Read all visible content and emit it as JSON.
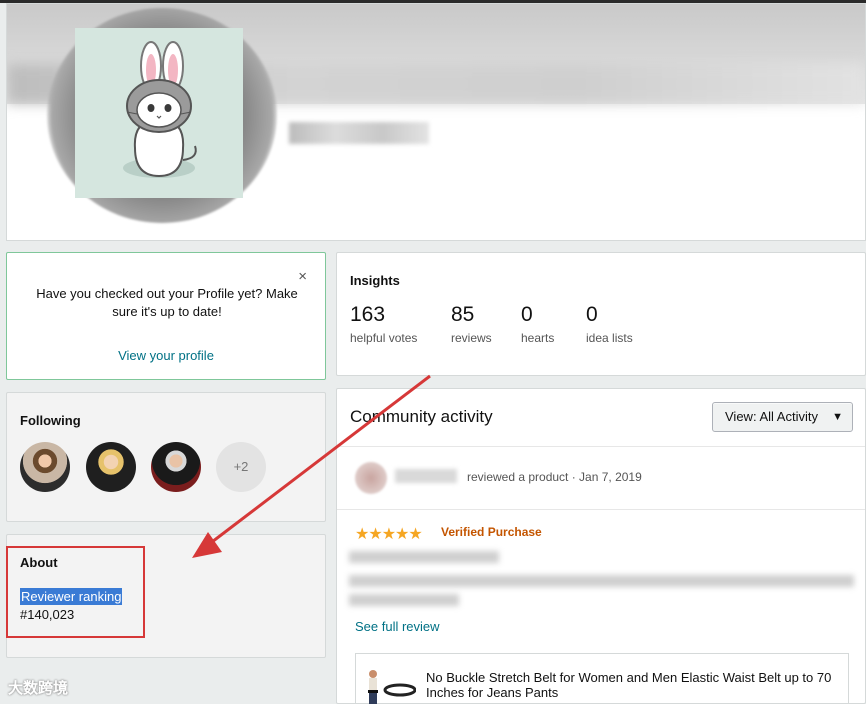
{
  "profile": {
    "avatar_alt": "bunny-hat cat avatar"
  },
  "profile_prompt": {
    "text": "Have you checked out your Profile yet? Make sure it's up to date!",
    "link": "View your profile",
    "close": "×"
  },
  "following": {
    "title": "Following",
    "more": "+2"
  },
  "about": {
    "title": "About",
    "rank_label": "Reviewer ranking",
    "rank_value": "#140,023"
  },
  "insights": {
    "title": "Insights",
    "stats": [
      {
        "value": "163",
        "label": "helpful votes"
      },
      {
        "value": "85",
        "label": "reviews"
      },
      {
        "value": "0",
        "label": "hearts"
      },
      {
        "value": "0",
        "label": "idea lists"
      }
    ]
  },
  "activity": {
    "title": "Community activity",
    "view_label": "View:  All Activity",
    "action": "reviewed a product · Jan 7, 2019",
    "stars": "★★★★★",
    "verified": "Verified Purchase",
    "see_review": "See full review",
    "product_title": "No Buckle Stretch Belt for Women and Men Elastic Waist Belt up to 70 Inches for Jeans Pants"
  },
  "watermark": "大数跨境",
  "colors": {
    "link": "#007185",
    "verified": "#c45500",
    "star": "#f5a623",
    "annotation": "#d63838"
  }
}
